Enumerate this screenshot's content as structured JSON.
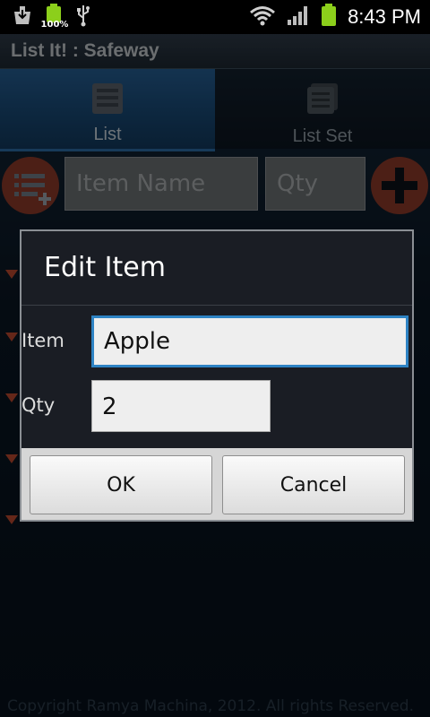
{
  "status_bar": {
    "battery_percent": "100%",
    "time": "8:43 PM",
    "icons": [
      "download-icon",
      "battery-full-icon",
      "usb-icon",
      "wifi-icon",
      "signal-icon",
      "battery-charging-icon"
    ]
  },
  "app": {
    "title": "List It! : Safeway",
    "tabs": [
      {
        "label": "List",
        "icon": "list-icon",
        "active": true
      },
      {
        "label": "List Set",
        "icon": "list-set-icon",
        "active": false
      }
    ],
    "item_input": {
      "placeholder": "Item Name",
      "value": ""
    },
    "qty_input": {
      "placeholder": "Qty",
      "value": ""
    },
    "footer": "Copyright Ramya Machina, 2012. All rights Reserved."
  },
  "dialog": {
    "title": "Edit Item",
    "item_label": "Item",
    "item_value": "Apple",
    "qty_label": "Qty",
    "qty_value": "2",
    "ok_label": "OK",
    "cancel_label": "Cancel"
  },
  "colors": {
    "accent_blue": "#2e83c4",
    "battery_green": "#8ccf1b",
    "add_red": "#8a3a28"
  }
}
